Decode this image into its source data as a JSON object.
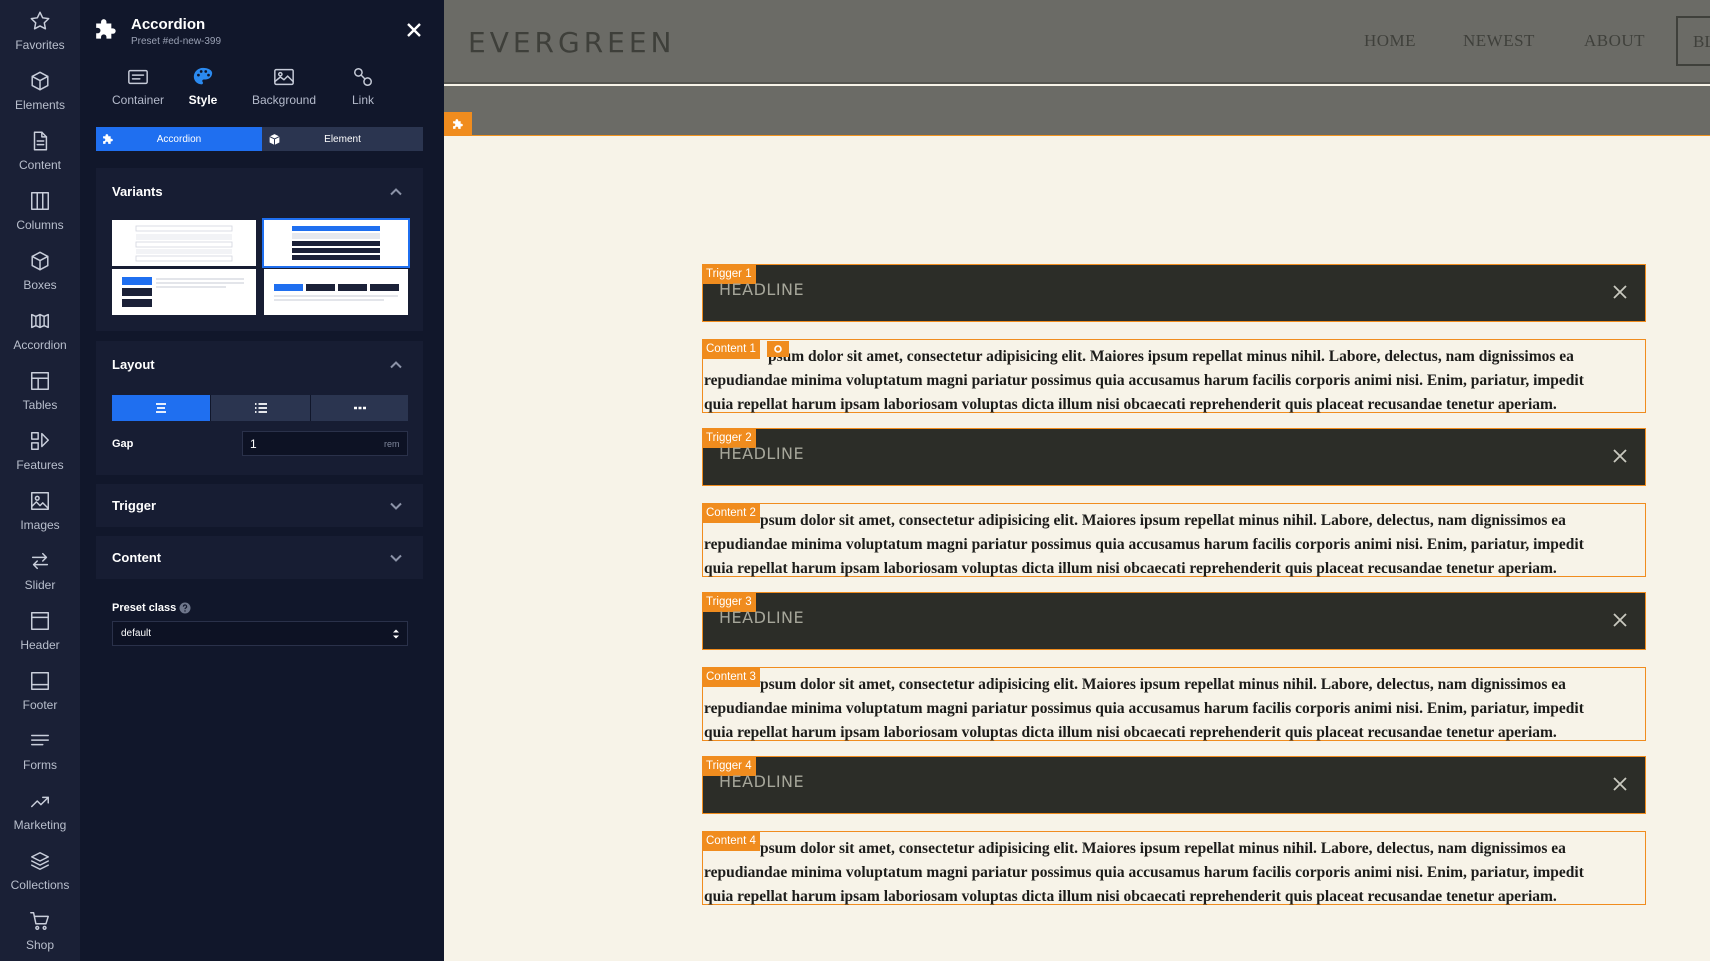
{
  "rail": [
    {
      "label": "Favorites",
      "icon": "star-icon"
    },
    {
      "label": "Elements",
      "icon": "cube-icon"
    },
    {
      "label": "Content",
      "icon": "document-icon"
    },
    {
      "label": "Columns",
      "icon": "columns-icon"
    },
    {
      "label": "Boxes",
      "icon": "box-icon"
    },
    {
      "label": "Accordion",
      "icon": "accordion-icon"
    },
    {
      "label": "Tables",
      "icon": "table-icon"
    },
    {
      "label": "Features",
      "icon": "features-icon"
    },
    {
      "label": "Images",
      "icon": "image-icon"
    },
    {
      "label": "Slider",
      "icon": "arrows-icon"
    },
    {
      "label": "Header",
      "icon": "header-icon"
    },
    {
      "label": "Footer",
      "icon": "footer-icon"
    },
    {
      "label": "Forms",
      "icon": "lines-icon"
    },
    {
      "label": "Marketing",
      "icon": "trend-icon"
    },
    {
      "label": "Collections",
      "icon": "layers-icon"
    },
    {
      "label": "Shop",
      "icon": "cart-icon"
    }
  ],
  "panel": {
    "title": "Accordion",
    "subtitle": "Preset #ed-new-399",
    "tabs": [
      {
        "label": "Container",
        "icon": "container-icon"
      },
      {
        "label": "Style",
        "icon": "palette-icon",
        "active": true
      },
      {
        "label": "Background",
        "icon": "image-icon"
      },
      {
        "label": "Link",
        "icon": "link-icon"
      }
    ],
    "segments": [
      "Accordion",
      "Element"
    ],
    "sections": {
      "variants": "Variants",
      "layout": "Layout",
      "trigger": "Trigger",
      "content": "Content"
    },
    "gap": {
      "label": "Gap",
      "value": "1",
      "unit": "rem"
    },
    "preset_class": {
      "label": "Preset class",
      "value": "default"
    }
  },
  "site": {
    "logo": "EVERGREEN",
    "nav": [
      "HOME",
      "NEWEST",
      "ABOUT",
      "BL"
    ]
  },
  "accordion": {
    "headline": "HEADLINE",
    "items": [
      {
        "trigger_tag": "Trigger 1",
        "content_tag": "Content 1",
        "line_start": "psum dolor sit amet, consectetur adipisicing elit. Maiores ipsum repellat minus nihil. Labore, delectus, nam dignissimos ea"
      },
      {
        "trigger_tag": "Trigger 2",
        "content_tag": "Content 2",
        "line_start": "psum dolor sit amet, consectetur adipisicing elit. Maiores ipsum repellat minus nihil. Labore, delectus, nam dignissimos ea"
      },
      {
        "trigger_tag": "Trigger 3",
        "content_tag": "Content 3",
        "line_start": "psum dolor sit amet, consectetur adipisicing elit. Maiores ipsum repellat minus nihil. Labore, delectus, nam dignissimos ea"
      },
      {
        "trigger_tag": "Trigger 4",
        "content_tag": "Content 4",
        "line_start": "psum dolor sit amet, consectetur adipisicing elit. Maiores ipsum repellat minus nihil. Labore, delectus, nam dignissimos ea"
      }
    ],
    "line2": "repudiandae minima voluptatum magni pariatur possimus quia accusamus harum facilis corporis animi nisi. Enim, pariatur, impedit",
    "line3": "quia repellat harum ipsam laboriosam voluptas dicta illum nisi obcaecati reprehenderit quis placeat recusandae tenetur aperiam."
  },
  "colors": {
    "accent": "#1f6ff0",
    "highlight": "#f08c1e"
  }
}
